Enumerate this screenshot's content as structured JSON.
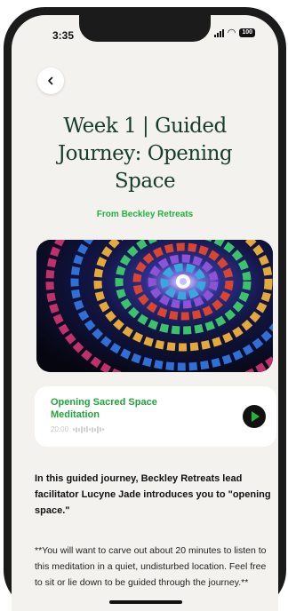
{
  "status_bar": {
    "time": "3:35",
    "battery": "100"
  },
  "header": {
    "title_lines": [
      "Week 1 | Guided",
      "Journey: Opening",
      "Space"
    ],
    "source": "From Beckley Retreats"
  },
  "hero_image": {
    "description_icon": "stained-glass-spiral-image"
  },
  "track": {
    "title": "Opening Sacred Space Meditation",
    "duration": "20:00",
    "play_icon": "play-icon",
    "accent": "#22b23d"
  },
  "description": {
    "intro_prefix": "In this ",
    "intro_bold_1": "guided journey, Beckley Retreats lead facilitator Lucyne Jade introduces you to",
    "intro_suffix": " \"opening space.\"",
    "note": "**You will want to carve out about 20 minutes to listen to this meditation in a quiet, undisturbed location. Feel free to sit or lie down to be guided through the journey.**"
  },
  "colors": {
    "title": "#163d2c",
    "accent_green": "#22b23d",
    "background": "#f4f2ee"
  }
}
